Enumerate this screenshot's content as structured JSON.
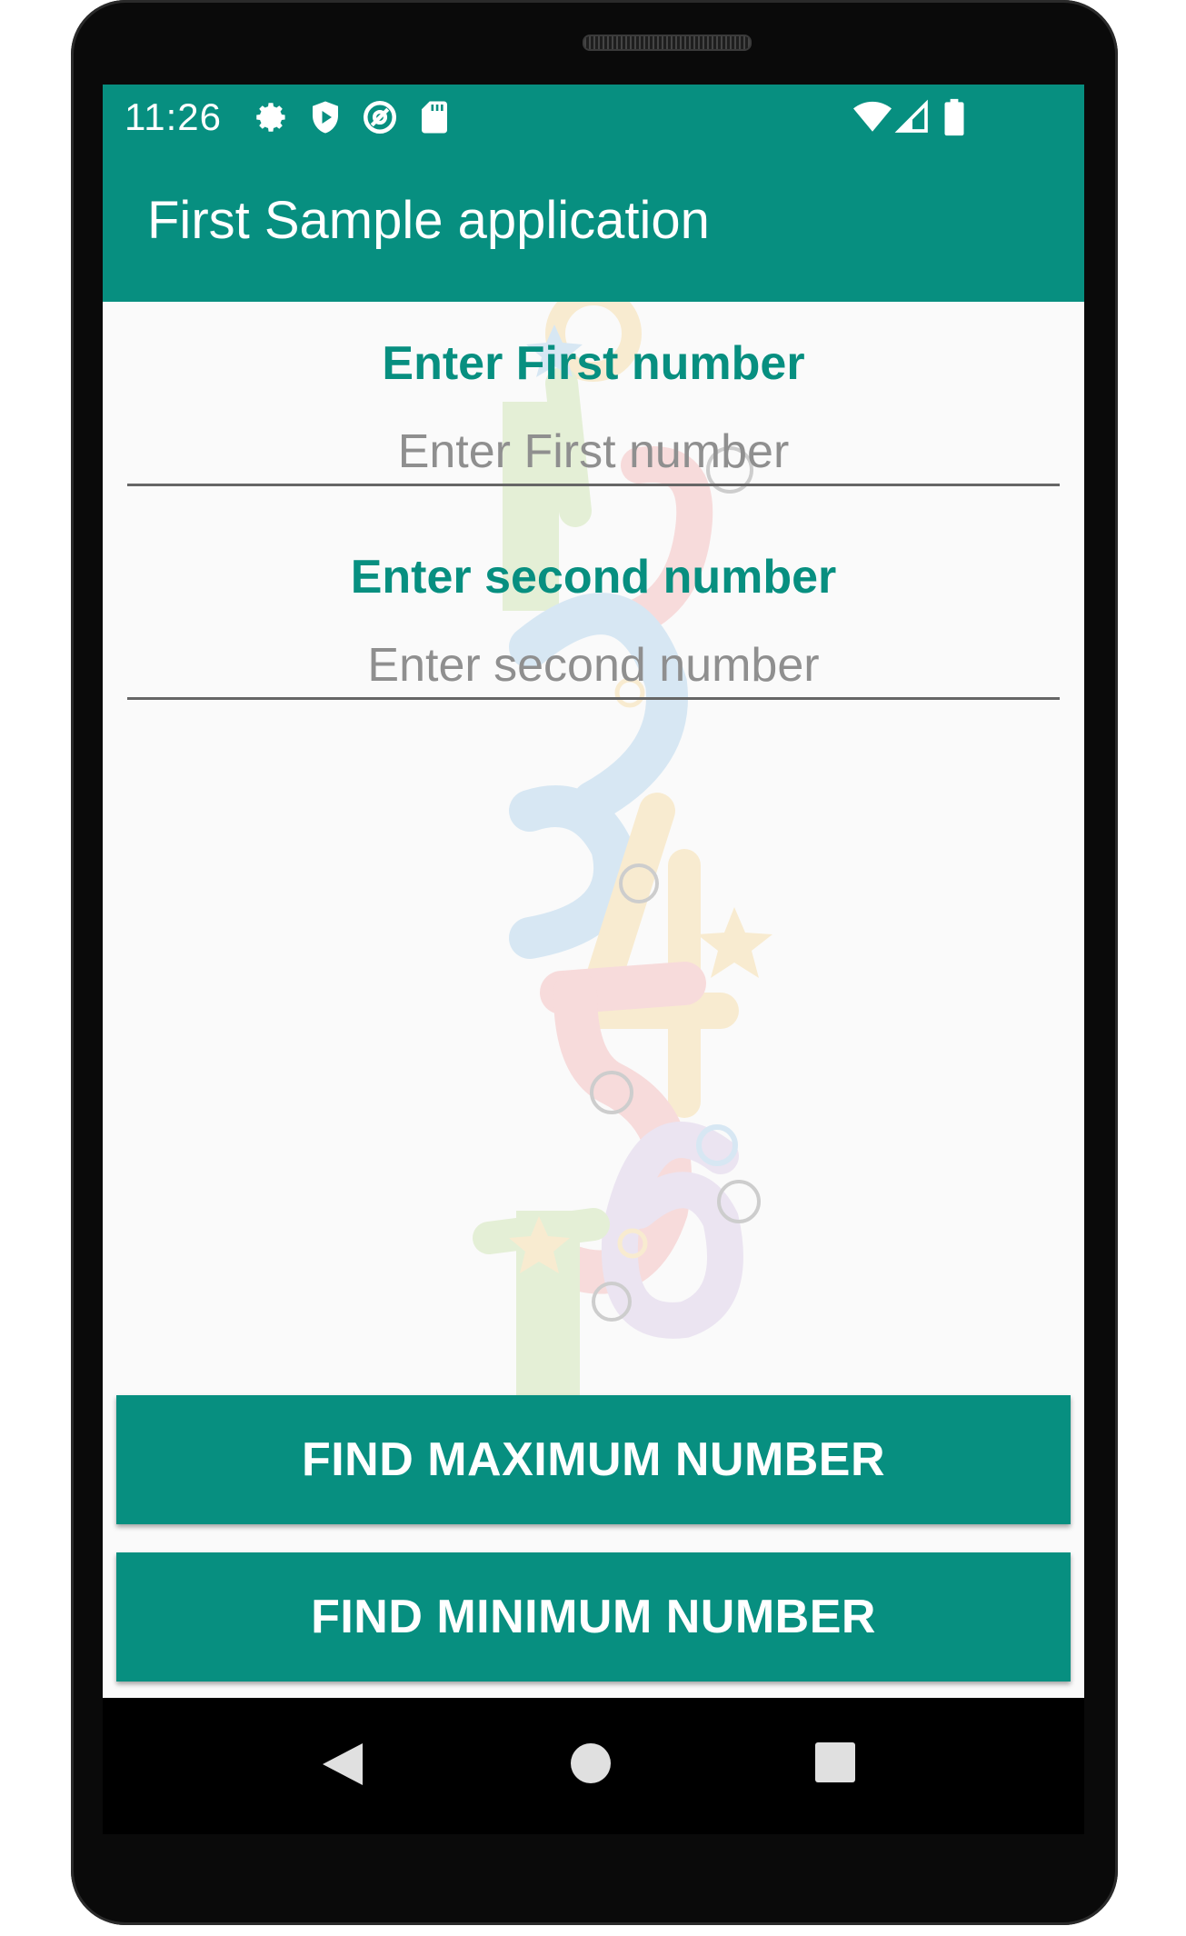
{
  "status_bar": {
    "time": "11:26",
    "icons": [
      "gear-icon",
      "shield-play-icon",
      "at-sign-icon",
      "sd-card-icon",
      "wifi-icon",
      "signal-icon",
      "battery-icon"
    ]
  },
  "app_bar": {
    "title": "First Sample application"
  },
  "form": {
    "first_label": "Enter First number",
    "first_placeholder": "Enter First number",
    "first_value": "",
    "second_label": "Enter second number",
    "second_placeholder": "Enter second number",
    "second_value": ""
  },
  "buttons": {
    "find_max_label": "FIND MAXIMUM NUMBER",
    "find_min_label": "FIND MINIMUM NUMBER"
  },
  "nav_bar": {
    "icons": [
      "back-icon",
      "home-icon",
      "recents-icon"
    ]
  },
  "colors": {
    "accent": "#078f80",
    "screen_background": "#fafafa",
    "hint_text": "#8f8f8f"
  }
}
